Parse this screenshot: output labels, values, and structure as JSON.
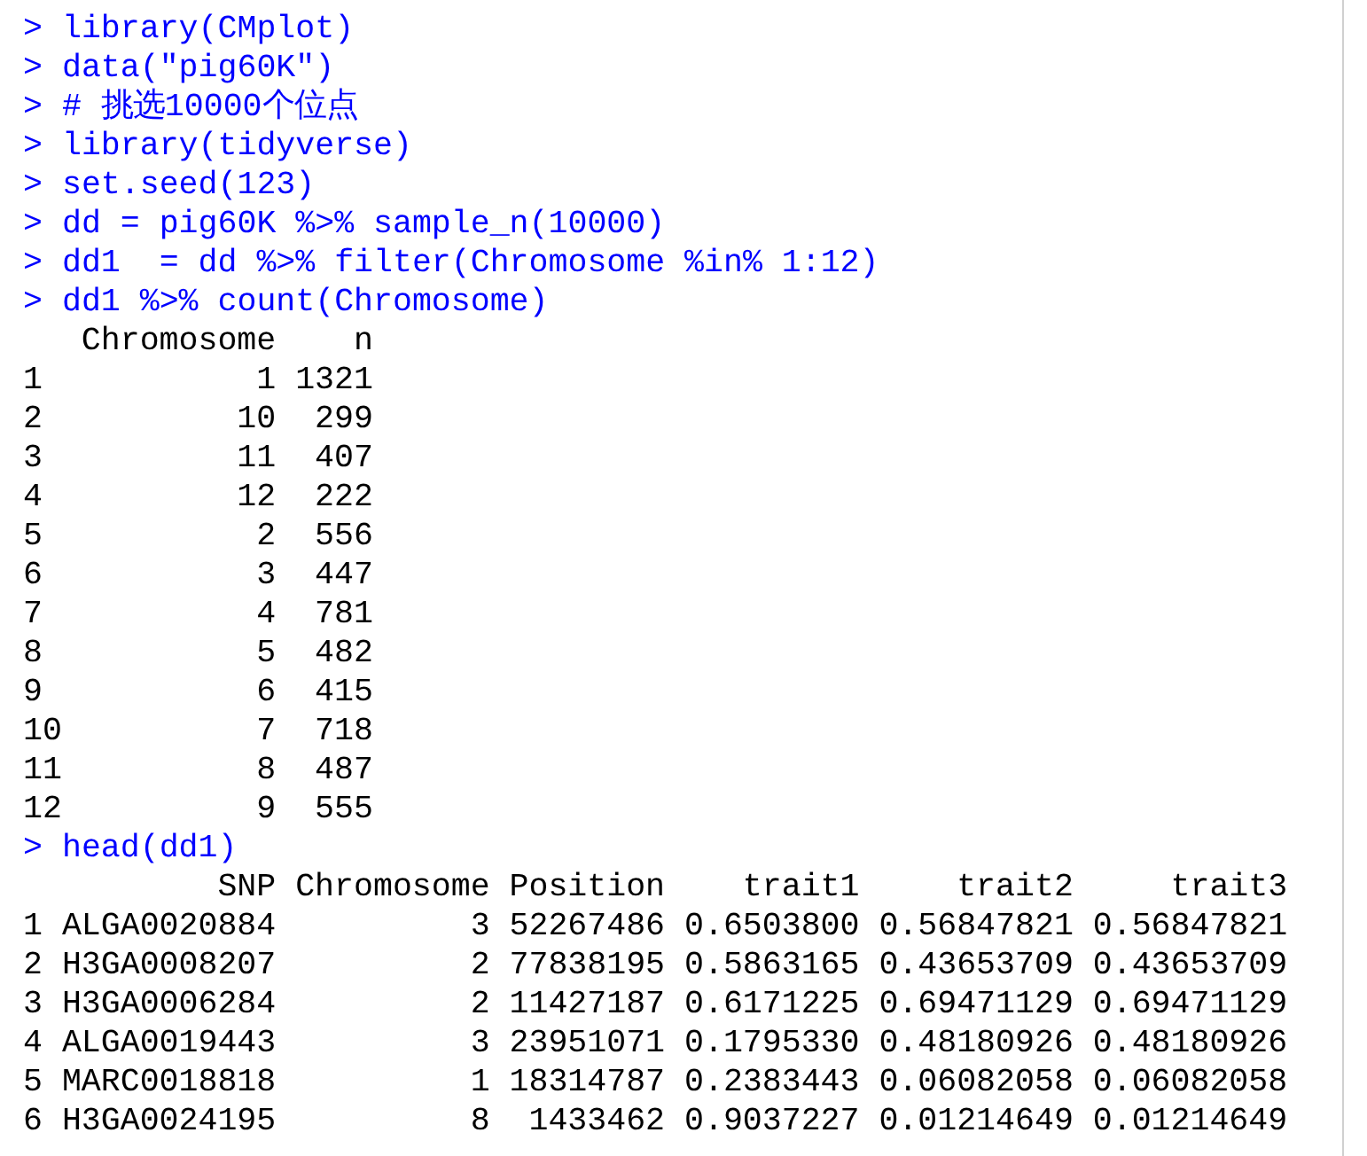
{
  "console": {
    "lines": [
      {
        "kind": "command",
        "prompt": ">",
        "text": "library(CMplot)"
      },
      {
        "kind": "command",
        "prompt": ">",
        "text": "data(\"pig60K\")"
      },
      {
        "kind": "command",
        "prompt": ">",
        "text": "# 挑选10000个位点"
      },
      {
        "kind": "command",
        "prompt": ">",
        "text": "library(tidyverse)"
      },
      {
        "kind": "command",
        "prompt": ">",
        "text": "set.seed(123)"
      },
      {
        "kind": "command",
        "prompt": ">",
        "text": "dd = pig60K %>% sample_n(10000)"
      },
      {
        "kind": "command",
        "prompt": ">",
        "text": "dd1  = dd %>% filter(Chromosome %in% 1:12)"
      },
      {
        "kind": "command",
        "prompt": ">",
        "text": "dd1 %>% count(Chromosome)"
      },
      {
        "kind": "output",
        "text": "   Chromosome    n"
      },
      {
        "kind": "output",
        "text": "1           1 1321"
      },
      {
        "kind": "output",
        "text": "2          10  299"
      },
      {
        "kind": "output",
        "text": "3          11  407"
      },
      {
        "kind": "output",
        "text": "4          12  222"
      },
      {
        "kind": "output",
        "text": "5           2  556"
      },
      {
        "kind": "output",
        "text": "6           3  447"
      },
      {
        "kind": "output",
        "text": "7           4  781"
      },
      {
        "kind": "output",
        "text": "8           5  482"
      },
      {
        "kind": "output",
        "text": "9           6  415"
      },
      {
        "kind": "output",
        "text": "10          7  718"
      },
      {
        "kind": "output",
        "text": "11          8  487"
      },
      {
        "kind": "output",
        "text": "12          9  555"
      },
      {
        "kind": "command",
        "prompt": ">",
        "text": "head(dd1)"
      },
      {
        "kind": "output",
        "text": "          SNP Chromosome Position    trait1     trait2     trait3"
      },
      {
        "kind": "output",
        "text": "1 ALGA0020884          3 52267486 0.6503800 0.56847821 0.56847821"
      },
      {
        "kind": "output",
        "text": "2 H3GA0008207          2 77838195 0.5863165 0.43653709 0.43653709"
      },
      {
        "kind": "output",
        "text": "3 H3GA0006284          2 11427187 0.6171225 0.69471129 0.69471129"
      },
      {
        "kind": "output",
        "text": "4 ALGA0019443          3 23951071 0.1795330 0.48180926 0.48180926"
      },
      {
        "kind": "output",
        "text": "5 MARC0018818          1 18314787 0.2383443 0.06082058 0.06082058"
      },
      {
        "kind": "output",
        "text": "6 H3GA0024195          8  1433462 0.9037227 0.01214649 0.01214649"
      }
    ]
  }
}
